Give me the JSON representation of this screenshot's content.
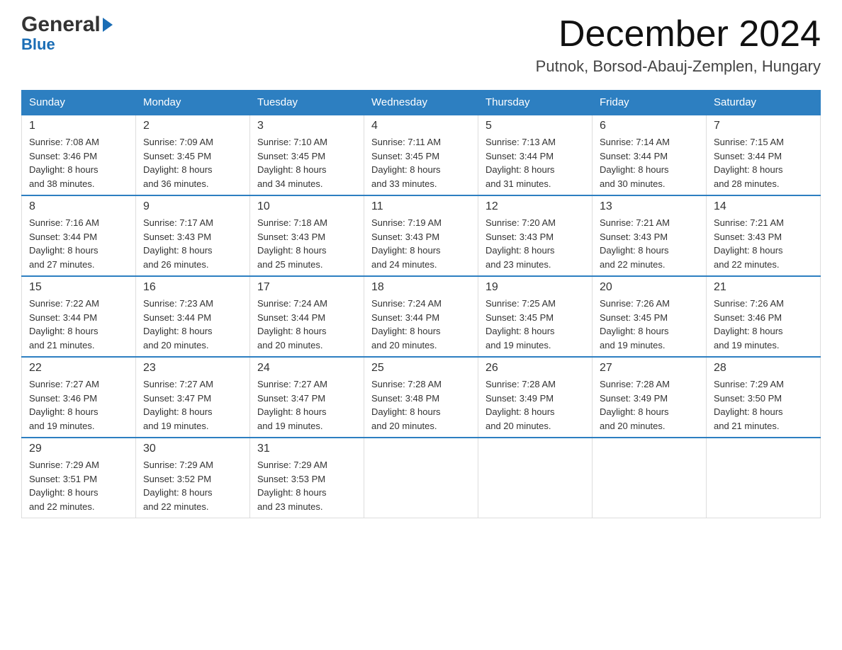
{
  "logo": {
    "general": "General",
    "blue": "Blue"
  },
  "header": {
    "month_year": "December 2024",
    "location": "Putnok, Borsod-Abauj-Zemplen, Hungary"
  },
  "weekdays": [
    "Sunday",
    "Monday",
    "Tuesday",
    "Wednesday",
    "Thursday",
    "Friday",
    "Saturday"
  ],
  "weeks": [
    [
      {
        "day": "1",
        "sunrise": "7:08 AM",
        "sunset": "3:46 PM",
        "daylight": "8 hours and 38 minutes."
      },
      {
        "day": "2",
        "sunrise": "7:09 AM",
        "sunset": "3:45 PM",
        "daylight": "8 hours and 36 minutes."
      },
      {
        "day": "3",
        "sunrise": "7:10 AM",
        "sunset": "3:45 PM",
        "daylight": "8 hours and 34 minutes."
      },
      {
        "day": "4",
        "sunrise": "7:11 AM",
        "sunset": "3:45 PM",
        "daylight": "8 hours and 33 minutes."
      },
      {
        "day": "5",
        "sunrise": "7:13 AM",
        "sunset": "3:44 PM",
        "daylight": "8 hours and 31 minutes."
      },
      {
        "day": "6",
        "sunrise": "7:14 AM",
        "sunset": "3:44 PM",
        "daylight": "8 hours and 30 minutes."
      },
      {
        "day": "7",
        "sunrise": "7:15 AM",
        "sunset": "3:44 PM",
        "daylight": "8 hours and 28 minutes."
      }
    ],
    [
      {
        "day": "8",
        "sunrise": "7:16 AM",
        "sunset": "3:44 PM",
        "daylight": "8 hours and 27 minutes."
      },
      {
        "day": "9",
        "sunrise": "7:17 AM",
        "sunset": "3:43 PM",
        "daylight": "8 hours and 26 minutes."
      },
      {
        "day": "10",
        "sunrise": "7:18 AM",
        "sunset": "3:43 PM",
        "daylight": "8 hours and 25 minutes."
      },
      {
        "day": "11",
        "sunrise": "7:19 AM",
        "sunset": "3:43 PM",
        "daylight": "8 hours and 24 minutes."
      },
      {
        "day": "12",
        "sunrise": "7:20 AM",
        "sunset": "3:43 PM",
        "daylight": "8 hours and 23 minutes."
      },
      {
        "day": "13",
        "sunrise": "7:21 AM",
        "sunset": "3:43 PM",
        "daylight": "8 hours and 22 minutes."
      },
      {
        "day": "14",
        "sunrise": "7:21 AM",
        "sunset": "3:43 PM",
        "daylight": "8 hours and 22 minutes."
      }
    ],
    [
      {
        "day": "15",
        "sunrise": "7:22 AM",
        "sunset": "3:44 PM",
        "daylight": "8 hours and 21 minutes."
      },
      {
        "day": "16",
        "sunrise": "7:23 AM",
        "sunset": "3:44 PM",
        "daylight": "8 hours and 20 minutes."
      },
      {
        "day": "17",
        "sunrise": "7:24 AM",
        "sunset": "3:44 PM",
        "daylight": "8 hours and 20 minutes."
      },
      {
        "day": "18",
        "sunrise": "7:24 AM",
        "sunset": "3:44 PM",
        "daylight": "8 hours and 20 minutes."
      },
      {
        "day": "19",
        "sunrise": "7:25 AM",
        "sunset": "3:45 PM",
        "daylight": "8 hours and 19 minutes."
      },
      {
        "day": "20",
        "sunrise": "7:26 AM",
        "sunset": "3:45 PM",
        "daylight": "8 hours and 19 minutes."
      },
      {
        "day": "21",
        "sunrise": "7:26 AM",
        "sunset": "3:46 PM",
        "daylight": "8 hours and 19 minutes."
      }
    ],
    [
      {
        "day": "22",
        "sunrise": "7:27 AM",
        "sunset": "3:46 PM",
        "daylight": "8 hours and 19 minutes."
      },
      {
        "day": "23",
        "sunrise": "7:27 AM",
        "sunset": "3:47 PM",
        "daylight": "8 hours and 19 minutes."
      },
      {
        "day": "24",
        "sunrise": "7:27 AM",
        "sunset": "3:47 PM",
        "daylight": "8 hours and 19 minutes."
      },
      {
        "day": "25",
        "sunrise": "7:28 AM",
        "sunset": "3:48 PM",
        "daylight": "8 hours and 20 minutes."
      },
      {
        "day": "26",
        "sunrise": "7:28 AM",
        "sunset": "3:49 PM",
        "daylight": "8 hours and 20 minutes."
      },
      {
        "day": "27",
        "sunrise": "7:28 AM",
        "sunset": "3:49 PM",
        "daylight": "8 hours and 20 minutes."
      },
      {
        "day": "28",
        "sunrise": "7:29 AM",
        "sunset": "3:50 PM",
        "daylight": "8 hours and 21 minutes."
      }
    ],
    [
      {
        "day": "29",
        "sunrise": "7:29 AM",
        "sunset": "3:51 PM",
        "daylight": "8 hours and 22 minutes."
      },
      {
        "day": "30",
        "sunrise": "7:29 AM",
        "sunset": "3:52 PM",
        "daylight": "8 hours and 22 minutes."
      },
      {
        "day": "31",
        "sunrise": "7:29 AM",
        "sunset": "3:53 PM",
        "daylight": "8 hours and 23 minutes."
      },
      null,
      null,
      null,
      null
    ]
  ],
  "labels": {
    "sunrise": "Sunrise: ",
    "sunset": "Sunset: ",
    "daylight": "Daylight: "
  }
}
